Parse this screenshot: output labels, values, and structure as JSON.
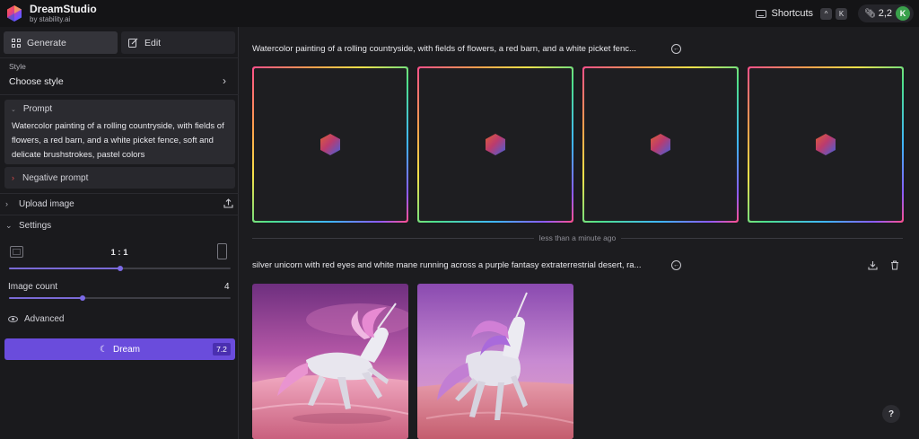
{
  "app": {
    "name": "DreamStudio",
    "byline": "by stability.ai"
  },
  "topbar": {
    "shortcuts_label": "Shortcuts",
    "shortcut_keys": [
      "^",
      "K"
    ],
    "credits": "2,2",
    "avatar_initial": "K",
    "avatar_color": "#3aa14c"
  },
  "sidebar": {
    "tabs": [
      {
        "label": "Generate",
        "icon": "grid-icon",
        "active": true
      },
      {
        "label": "Edit",
        "icon": "edit-icon",
        "active": false
      }
    ],
    "style": {
      "label": "Style",
      "value": "Choose style"
    },
    "prompt": {
      "label": "Prompt",
      "text": "Watercolor painting of a rolling countryside, with fields of flowers, a red barn, and a white picket fence, soft and delicate brushstrokes, pastel colors"
    },
    "negative_prompt_label": "Negative prompt",
    "upload_image_label": "Upload image",
    "settings_label": "Settings",
    "aspect_ratio": {
      "value": "1 : 1",
      "slider_fraction": 0.5
    },
    "image_count": {
      "label": "Image count",
      "value": "4",
      "slider_fraction": 0.33
    },
    "advanced_label": "Advanced",
    "dream_button": {
      "label": "Dream",
      "cost": "7.2",
      "color": "#6a4cdc"
    }
  },
  "main": {
    "generations": [
      {
        "prompt": "Watercolor painting of a rolling countryside, with fields of flowers, a red barn, and a white picket fenc...",
        "state": "generating",
        "image_count": 4
      },
      {
        "prompt": "silver unicorn with red eyes and white mane running across a purple fantasy extraterrestrial desert, ra...",
        "state": "complete",
        "image_count": 2
      }
    ],
    "time_separator": "less than a minute ago",
    "help_label": "?"
  },
  "colors": {
    "accent": "#6a4cdc",
    "background": "#1c1c1f",
    "sidebar": "#1a1a1d",
    "negative_x": "#e04a4a"
  }
}
